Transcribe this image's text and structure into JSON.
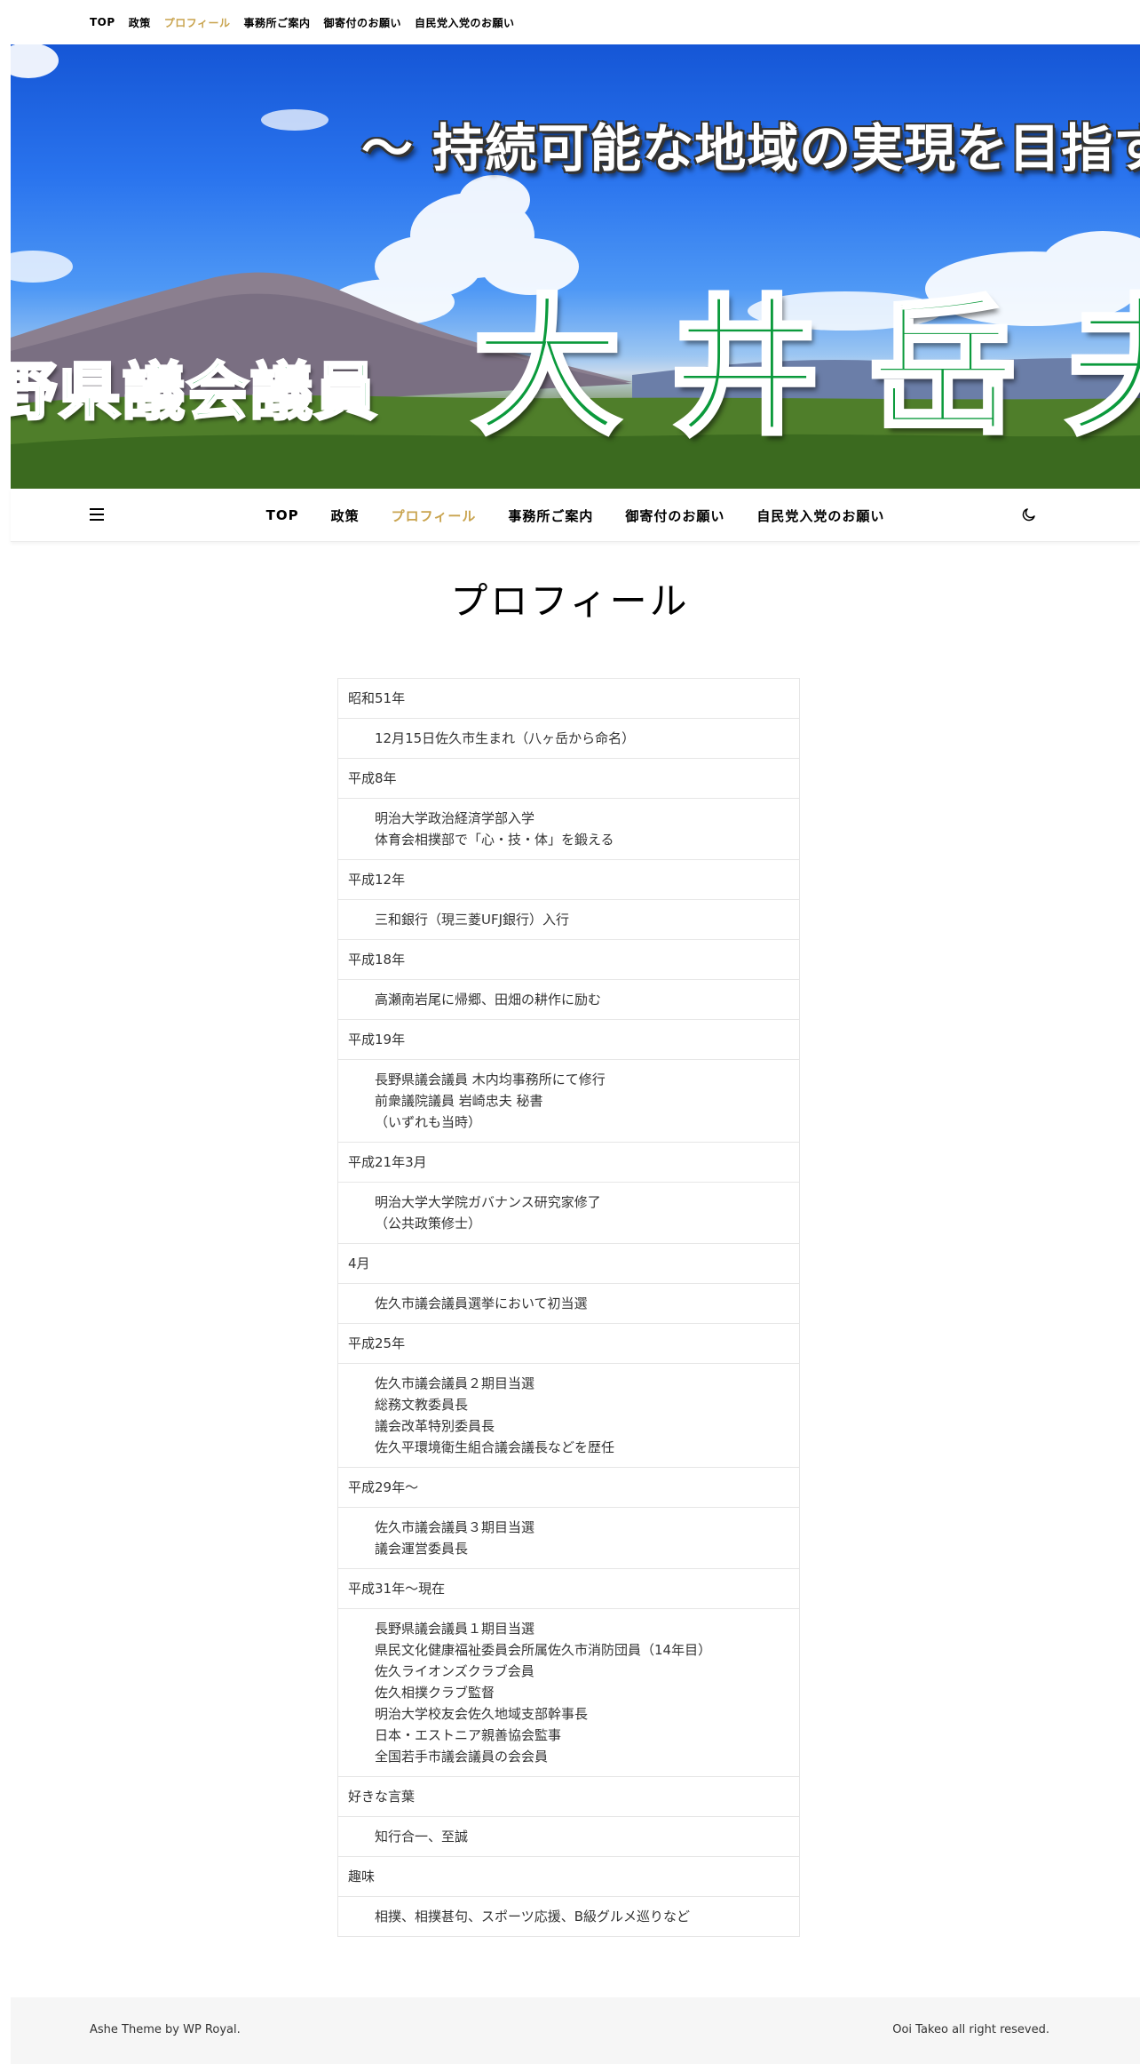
{
  "top_nav": {
    "items": [
      "TOP",
      "政策",
      "プロフィール",
      "事務所ご案内",
      "御寄付のお願い",
      "自民党入党のお願い"
    ],
    "active_index": 2
  },
  "banner": {
    "tagline": "～ 持続可能な地域の実現を目指す",
    "role": "野県議会議員",
    "name": "大井岳夫"
  },
  "main_nav": {
    "menu_icon": "hamburger-icon",
    "items": [
      "TOP",
      "政策",
      "プロフィール",
      "事務所ご案内",
      "御寄付のお願い",
      "自民党入党のお願い"
    ],
    "active_index": 2,
    "dark_mode_icon": "moon-icon"
  },
  "page": {
    "title": "プロフィール"
  },
  "profile": [
    {
      "year": "昭和51年",
      "lines": [
        "12月15日佐久市生まれ（八ヶ岳から命名）"
      ]
    },
    {
      "year": "平成8年",
      "lines": [
        "明治大学政治経済学部入学",
        "体育会相撲部で「心・技・体」を鍛える"
      ]
    },
    {
      "year": "平成12年",
      "lines": [
        "三和銀行（現三菱UFJ銀行）入行"
      ]
    },
    {
      "year": "平成18年",
      "lines": [
        "高瀬南岩尾に帰郷、田畑の耕作に励む"
      ]
    },
    {
      "year": "平成19年",
      "lines": [
        "長野県議会議員 木内均事務所にて修行",
        "前衆議院議員 岩崎忠夫 秘書",
        "（いずれも当時）"
      ]
    },
    {
      "year": "平成21年3月",
      "lines": [
        "明治大学大学院ガバナンス研究家修了",
        "（公共政策修士）"
      ]
    },
    {
      "year": "4月",
      "lines": [
        "佐久市議会議員選挙において初当選"
      ]
    },
    {
      "year": "平成25年",
      "lines": [
        "佐久市議会議員２期目当選",
        "総務文教委員長",
        "議会改革特別委員長",
        "佐久平環境衛生組合議会議長などを歴任"
      ]
    },
    {
      "year": "平成29年～",
      "lines": [
        "佐久市議会議員３期目当選",
        "議会運営委員長"
      ]
    },
    {
      "year": "平成31年～現在",
      "lines": [
        "長野県議会議員１期目当選",
        "県民文化健康福祉委員会所属佐久市消防団員（14年目）",
        "佐久ライオンズクラブ会員",
        "佐久相撲クラブ監督",
        "明治大学校友会佐久地域支部幹事長",
        "日本・エストニア親善協会監事",
        "全国若手市議会議員の会会員"
      ]
    },
    {
      "year": "好きな言葉",
      "lines": [
        "知行合一、至誠"
      ]
    },
    {
      "year": "趣味",
      "lines": [
        "相撲、相撲甚句、スポーツ応援、B級グルメ巡りなど"
      ]
    }
  ],
  "footer": {
    "left": "Ashe Theme by WP Royal.",
    "right": "Ooi Takeo all right reseved."
  },
  "colors": {
    "accent": "#c9a44f",
    "name_green": "#0b9a3c",
    "footer_bg": "#f6f6f6",
    "table_border": "#e6e6e6"
  }
}
